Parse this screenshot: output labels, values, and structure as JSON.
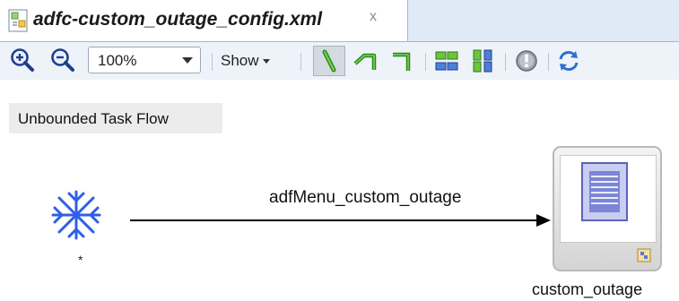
{
  "tab": {
    "title": "adfc-custom_outage_config.xml",
    "close": "x"
  },
  "toolbar": {
    "zoom_value": "100%",
    "show_label": "Show"
  },
  "canvas": {
    "flow_label": "Unbounded Task Flow",
    "start_label": "*",
    "edge_label": "adfMenu_custom_outage",
    "view_label": "custom_outage"
  },
  "colors": {
    "accent": "#4a62c8",
    "start": "#2f5ee8",
    "tab_bg": "#dfeaf6"
  }
}
